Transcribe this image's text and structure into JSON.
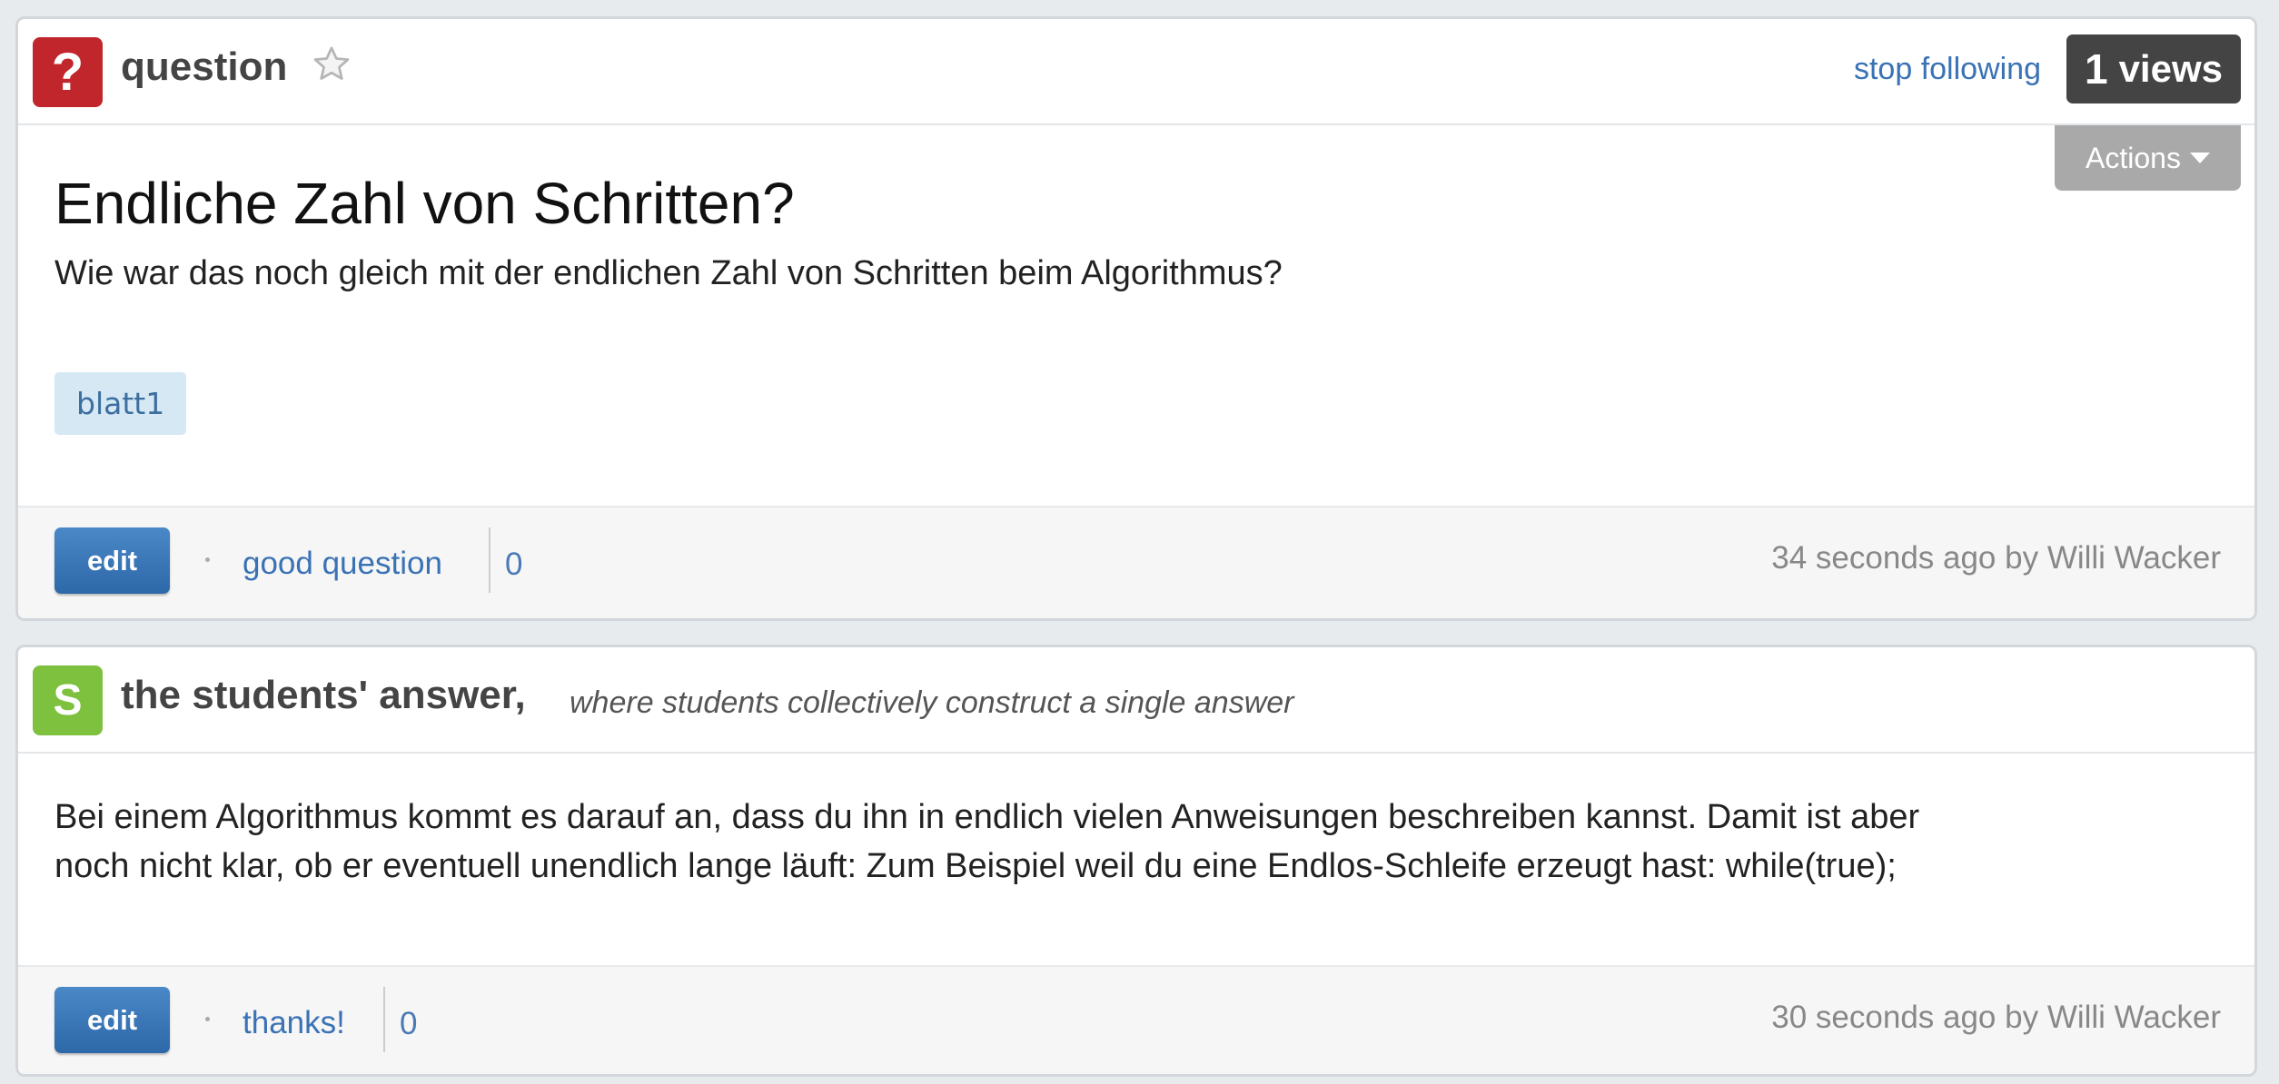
{
  "question": {
    "type_badge": "?",
    "type_label": "question",
    "stop_following_label": "stop following",
    "views_count": "1",
    "views_label": "views",
    "actions_label": "Actions",
    "title": "Endliche Zahl von Schritten?",
    "body": "Wie war das noch gleich mit der endlichen Zahl von Schritten beim Algorithmus?",
    "tags": [
      "blatt1"
    ],
    "edit_label": "edit",
    "vote_label": "good question",
    "vote_count": "0",
    "meta": "34 seconds ago by Willi Wacker"
  },
  "students_answer": {
    "type_badge": "S",
    "title": "the students' answer,",
    "subtitle": "where students collectively construct a single answer",
    "body_lines": [
      "Bei einem Algorithmus kommt es darauf an, dass du ihn in endlich vielen Anweisungen beschreiben kannst. Damit ist aber",
      "noch nicht klar, ob er eventuell unendlich lange läuft: Zum Beispiel weil du eine Endlos-Schleife erzeugt hast: while(true);"
    ],
    "edit_label": "edit",
    "vote_label": "thanks!",
    "vote_count": "0",
    "meta": "30 seconds ago by Willi Wacker"
  },
  "colors": {
    "question_badge": "#c0262c",
    "students_badge": "#7dc13f",
    "link": "#3a72b5",
    "edit_button": "#3577b8",
    "tag_bg": "#d5e8f3"
  },
  "icons": {
    "favorite": "star-icon",
    "actions_dropdown": "caret-down-icon"
  }
}
